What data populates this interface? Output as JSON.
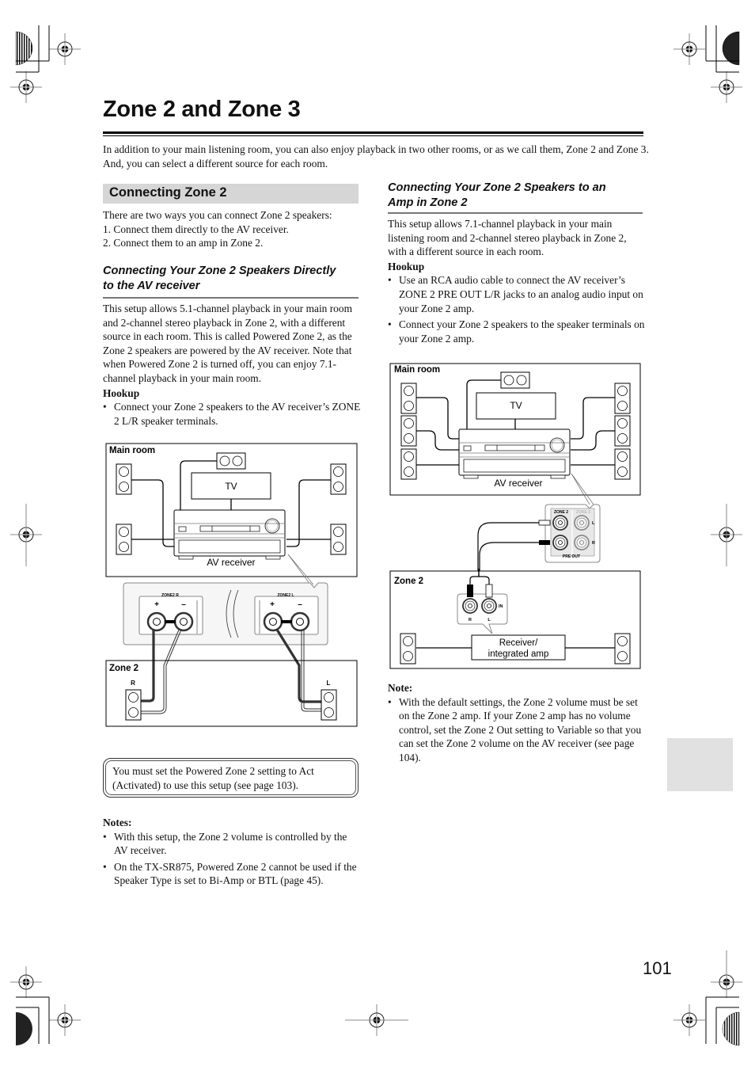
{
  "page": {
    "title": "Zone 2 and Zone 3",
    "intro": "In addition to your main listening room, you can also enjoy playback in two other rooms, or as we call them, Zone 2 and Zone 3. And, you can select a different source for each room.",
    "page_number": "101"
  },
  "left": {
    "section_title": "Connecting Zone 2",
    "ways_intro": "There are two ways you can connect Zone 2 speakers:",
    "ways": [
      "1. Connect them directly to the AV receiver.",
      "2. Connect them to an amp in Zone 2."
    ],
    "subheading_line1": "Connecting Your Zone 2 Speakers Directly",
    "subheading_line2": "to the AV receiver",
    "body": "This setup allows 5.1-channel playback in your main room and 2-channel stereo playback in Zone 2, with a different source in each room. This is called Powered Zone 2, as the Zone 2 speakers are powered by the AV receiver. Note that when Powered Zone 2 is turned off, you can enjoy 7.1-channel playback in your main room.",
    "hookup_label": "Hookup",
    "hookup_items": [
      "Connect your Zone 2 speakers to the AV receiver’s ZONE 2 L/R speaker terminals."
    ],
    "diagram": {
      "main_room_label": "Main room",
      "tv_label": "TV",
      "receiver_label": "AV receiver",
      "zone2r_label": "ZONE2 R",
      "zone2l_label": "ZONE2 L",
      "plus": "+",
      "minus": "–",
      "zone2_label": "Zone 2",
      "r_label": "R",
      "l_label": "L"
    },
    "callout": "You must set the Powered Zone 2 setting to Act (Activated) to use this setup (see page 103).",
    "notes_label": "Notes:",
    "notes": [
      "With this setup, the Zone 2 volume is controlled by the AV receiver.",
      "On the TX-SR875, Powered Zone 2 cannot be used if the Speaker Type is set to Bi-Amp or BTL (page 45)."
    ]
  },
  "right": {
    "subheading_line1": "Connecting Your Zone 2 Speakers to an",
    "subheading_line2": "Amp in Zone 2",
    "body": "This setup allows 7.1-channel playback in your main listening room and 2-channel stereo playback in Zone 2, with a different source in each room.",
    "hookup_label": "Hookup",
    "hookup_items": [
      "Use an RCA audio cable to connect the AV receiver’s ZONE 2 PRE OUT L/R jacks to an analog audio input on your Zone 2 amp.",
      "Connect your Zone 2 speakers to the speaker terminals on your Zone 2 amp."
    ],
    "diagram": {
      "main_room_label": "Main room",
      "tv_label": "TV",
      "receiver_label": "AV receiver",
      "zone2_jack_label": "ZONE 2",
      "zone3_jack_label": "ZONE 3",
      "pre_out_label": "PRE OUT",
      "l_label": "L",
      "r_label": "R",
      "zone2_label": "Zone 2",
      "in_label": "IN",
      "amp_label_line1": "Receiver/",
      "amp_label_line2": "integrated amp"
    },
    "note_label": "Note:",
    "notes": [
      "With the default settings, the Zone 2 volume must be set on the Zone 2 amp. If your Zone 2 amp has no volume control, set the Zone 2 Out setting to Variable so that you can set the Zone 2 volume on the AV receiver (see page 104)."
    ]
  }
}
